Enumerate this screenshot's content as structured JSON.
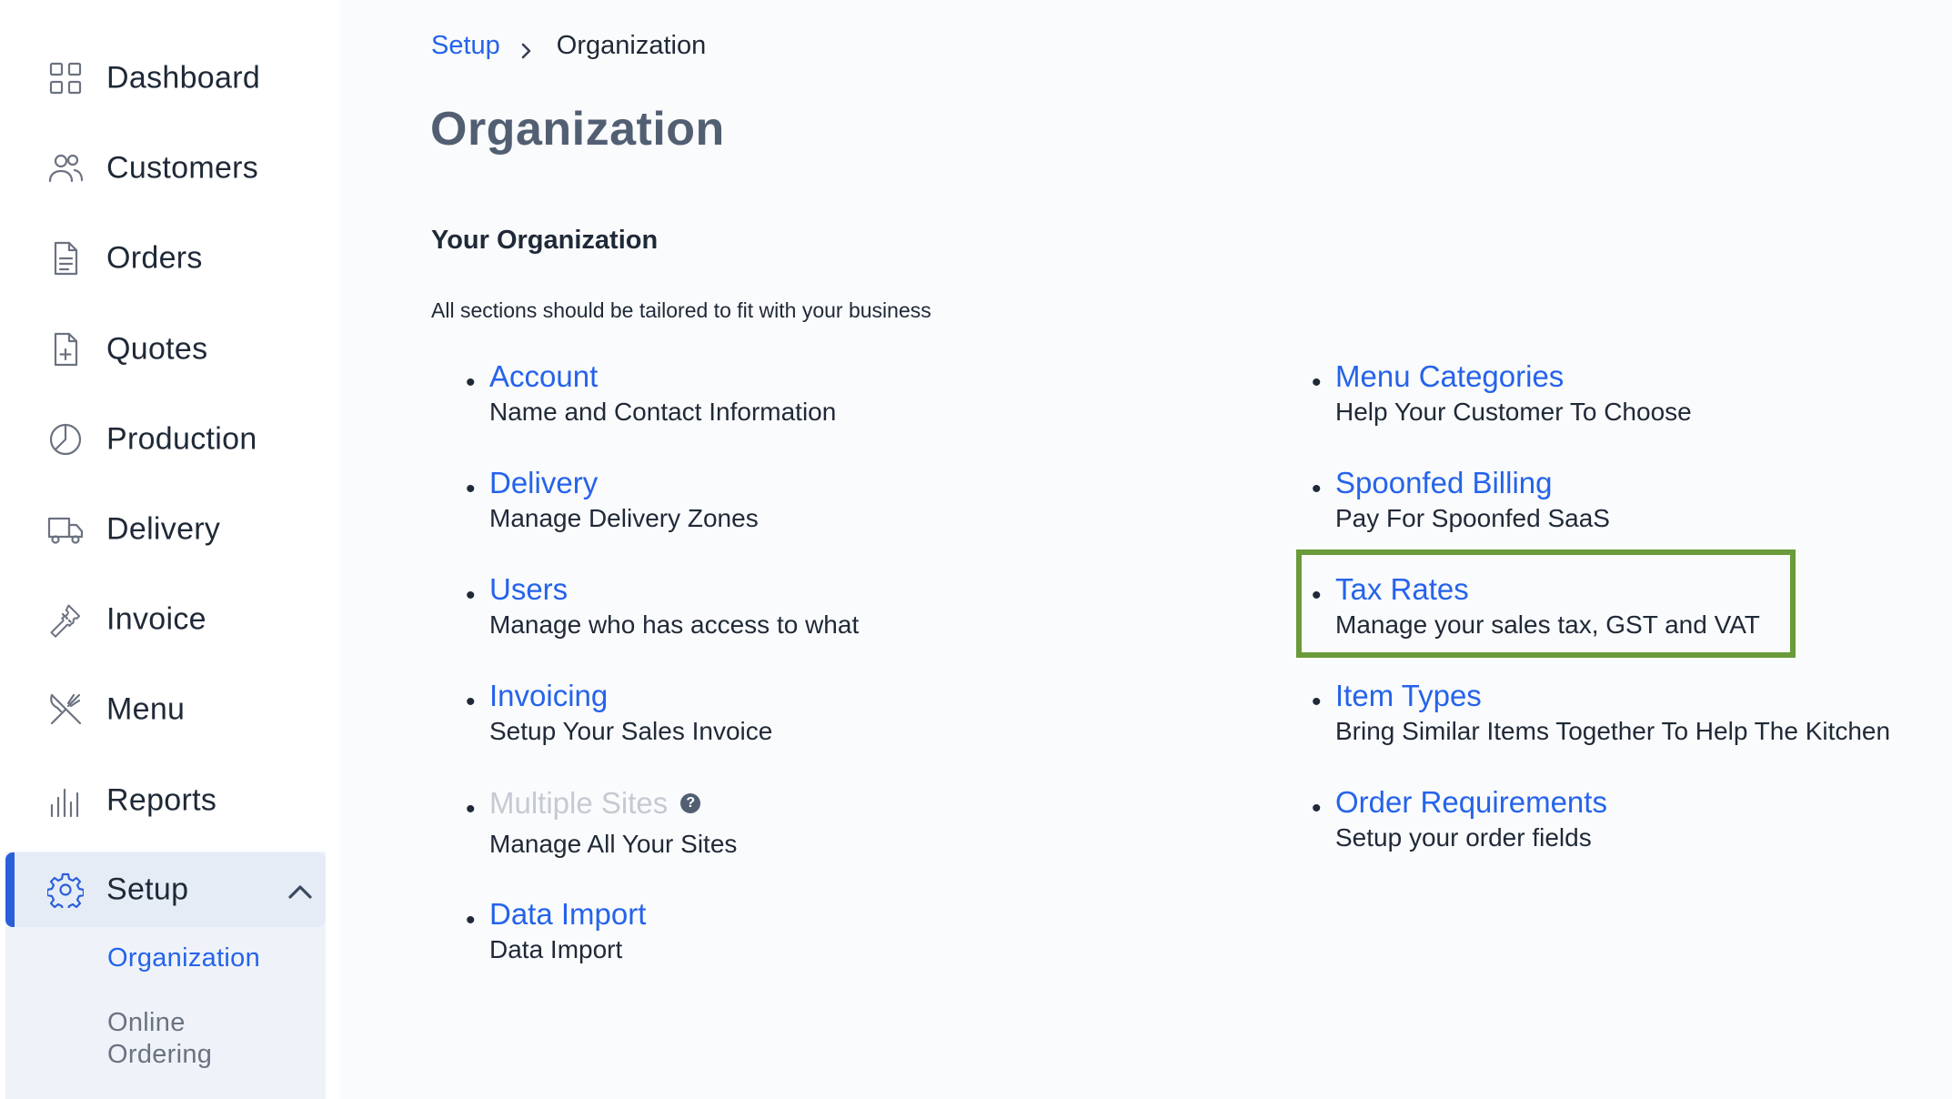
{
  "sidebar": {
    "items": [
      {
        "label": "Dashboard",
        "icon": "dashboard-icon"
      },
      {
        "label": "Customers",
        "icon": "users-icon"
      },
      {
        "label": "Orders",
        "icon": "document-icon"
      },
      {
        "label": "Quotes",
        "icon": "document-plus-icon"
      },
      {
        "label": "Production",
        "icon": "pie-chart-icon"
      },
      {
        "label": "Delivery",
        "icon": "truck-icon"
      },
      {
        "label": "Invoice",
        "icon": "ticket-icon"
      },
      {
        "label": "Menu",
        "icon": "utensils-icon"
      },
      {
        "label": "Reports",
        "icon": "bar-chart-icon"
      },
      {
        "label": "Setup",
        "icon": "gear-icon"
      }
    ],
    "setup_sub": [
      {
        "label": "Organization"
      },
      {
        "label": "Online Ordering"
      }
    ],
    "active_color": "#2563eb"
  },
  "breadcrumb": {
    "parent": "Setup",
    "current": "Organization"
  },
  "page": {
    "title": "Organization",
    "section_title": "Your Organization",
    "section_desc": "All sections should be tailored to fit with your business"
  },
  "left_entries": [
    {
      "link": "Account",
      "desc": "Name and Contact Information"
    },
    {
      "link": "Delivery",
      "desc": "Manage Delivery Zones"
    },
    {
      "link": "Users",
      "desc": "Manage who has access to what"
    },
    {
      "link": "Invoicing",
      "desc": "Setup Your Sales Invoice"
    },
    {
      "link": "Multiple Sites",
      "desc": "Manage All Your Sites",
      "help": "?"
    },
    {
      "link": "Data Import",
      "desc": "Data Import"
    }
  ],
  "right_entries": [
    {
      "link": "Menu Categories",
      "desc": "Help Your Customer To Choose"
    },
    {
      "link": "Spoonfed Billing",
      "desc": "Pay For Spoonfed SaaS"
    },
    {
      "link": "Tax Rates",
      "desc": "Manage your sales tax, GST and VAT"
    },
    {
      "link": "Item Types",
      "desc": "Bring Similar Items Together To Help The Kitchen"
    },
    {
      "link": "Order Requirements",
      "desc": "Setup your order fields"
    }
  ],
  "highlight_color": "#6a9a3a"
}
